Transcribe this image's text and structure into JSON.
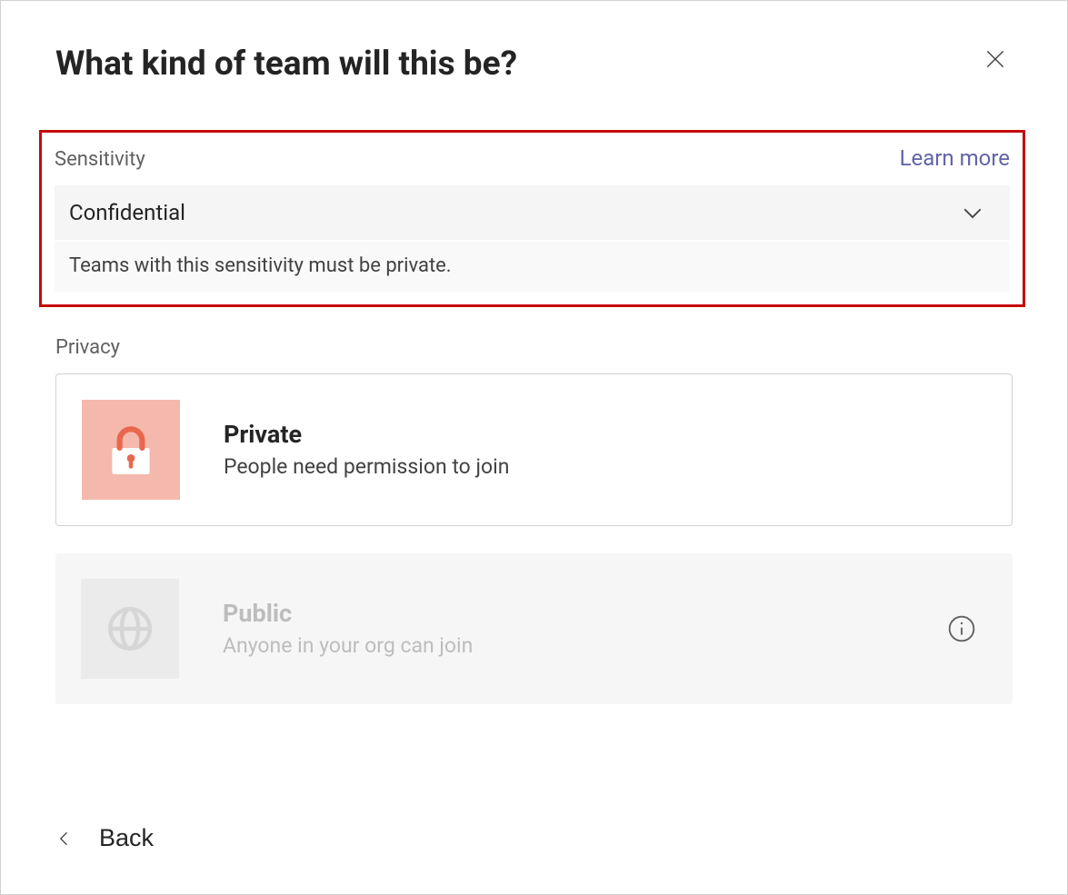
{
  "header": {
    "title": "What kind of team will this be?"
  },
  "sensitivity": {
    "label": "Sensitivity",
    "learn_more": "Learn more",
    "selected": "Confidential",
    "note": "Teams with this sensitivity must be private."
  },
  "privacy": {
    "label": "Privacy",
    "options": {
      "private": {
        "title": "Private",
        "desc": "People need permission to join"
      },
      "public": {
        "title": "Public",
        "desc": "Anyone in your org can join"
      }
    }
  },
  "footer": {
    "back": "Back"
  }
}
